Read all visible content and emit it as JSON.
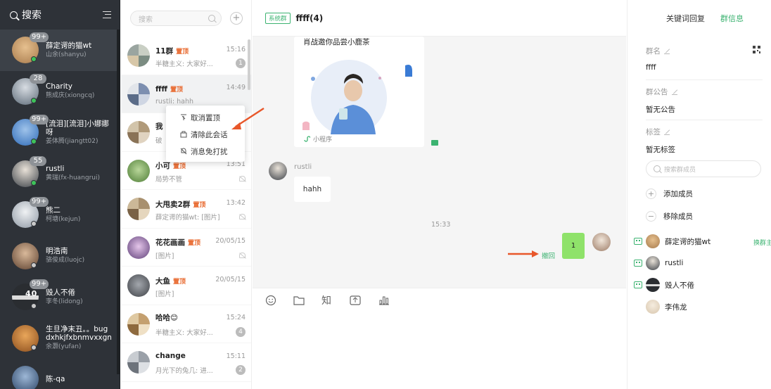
{
  "sidebar": {
    "search_label": "搜索",
    "contacts": [
      {
        "badge": "99+",
        "name": "薛定谔的猫wt",
        "sub": "山余(shanyu)",
        "status": "green",
        "color": "#c89a6a"
      },
      {
        "badge": "28",
        "name": "Charity",
        "sub": "熊成庆(xiongcq)",
        "status": "green",
        "color": "#6d7b8a"
      },
      {
        "badge": "99+",
        "name": "[流泪][流泪]小娜娜呀",
        "sub": "姜体腾(jiangtt02)",
        "status": "green",
        "color": "#5b8ed0"
      },
      {
        "badge": "55",
        "name": "rustli",
        "sub": "黄瑞(fx-huangrui)",
        "status": "green",
        "color": "#4a4f57"
      },
      {
        "badge": "99+",
        "name": "熊二",
        "sub": "柯塘(kejun)",
        "status": "grey",
        "color": "#aab3bd"
      },
      {
        "badge": "",
        "name": "明浩南",
        "sub": "骆俊成(luojc)",
        "status": "grey",
        "color": "#8a6a55"
      },
      {
        "badge": "99+",
        "name": "毁人不倦",
        "sub": "李冬(lidong)",
        "status": "grey",
        "color": "#3a3d42",
        "overlay": "40"
      },
      {
        "badge": "",
        "name": "生旦净末丑。。bug dxhkjfxbnmvxxgn",
        "sub": "余灏(yufan)",
        "status": "grey",
        "color": "#c5782f"
      },
      {
        "badge": "",
        "name": "陈-qa",
        "sub": "",
        "status": "grey",
        "color": "#5b7aa3"
      }
    ]
  },
  "list": {
    "search_placeholder": "搜索",
    "plus": "+",
    "pin_label": "置顶",
    "conversations": [
      {
        "name": "11群",
        "pinned": true,
        "time": "15:16",
        "preview": "半糖主义:  大家好...",
        "count": "1",
        "muted": false,
        "color": "#9aa5a0"
      },
      {
        "name": "ffff",
        "pinned": true,
        "time": "14:49",
        "preview": "rustli:  hahh",
        "count": "",
        "muted": false,
        "color": "#7d8fb0"
      },
      {
        "name": "我",
        "pinned": false,
        "time": "",
        "preview": "破",
        "count": "",
        "muted": false,
        "color": "#b09a7a"
      },
      {
        "name": "小可",
        "pinned": true,
        "time": "13:51",
        "preview": "局势不管",
        "count": "",
        "muted": true,
        "color": "#7aa860"
      },
      {
        "name": "大甩卖2群",
        "pinned": true,
        "time": "13:42",
        "preview": "薛定谔的猫wt:  [图片]",
        "count": "",
        "muted": true,
        "color": "#a8906e"
      },
      {
        "name": "花花画画",
        "pinned": true,
        "time": "20/05/15",
        "preview": "[图片]",
        "count": "",
        "muted": true,
        "color": "#8a6aa0"
      },
      {
        "name": "大鱼",
        "pinned": true,
        "time": "20/05/15",
        "preview": "[图片]",
        "count": "",
        "muted": false,
        "color": "#6b6e73"
      },
      {
        "name": "哈哈😊",
        "pinned": false,
        "time": "15:24",
        "preview": "半糖主义:  大家好...",
        "count": "4",
        "muted": false,
        "color": "#c4a070"
      },
      {
        "name": "change",
        "pinned": false,
        "time": "15:11",
        "preview": "月光下的兔几:  进...",
        "count": "2",
        "muted": false,
        "color": "#9aa0a8"
      }
    ]
  },
  "context_menu": {
    "items": [
      "取消置顶",
      "清除此会话",
      "消息免打扰"
    ]
  },
  "chat": {
    "system_tag": "系统群",
    "title": "ffff(4)",
    "card_title": "肖战邀你品尝小鹿茶",
    "card_footer": "小程序",
    "sender": "rustli",
    "message": "hahh",
    "timestamp": "15:33",
    "my_message": "1",
    "recall": "撤回",
    "toolbar": {
      "knowledge": "知"
    }
  },
  "right": {
    "tabs": [
      "关键词回复",
      "群信息"
    ],
    "group_name_label": "群名",
    "group_name": "ffff",
    "announcement_label": "群公告",
    "announcement": "暂无公告",
    "tag_label": "标签",
    "tag_value": "暂无标签",
    "member_search_placeholder": "搜索群成员",
    "add_member": "添加成员",
    "remove_member": "移除成员",
    "transfer_owner": "换群主",
    "members": [
      {
        "name": "薛定谔的猫wt",
        "robot": true,
        "color": "#c89a6a"
      },
      {
        "name": "rustli",
        "robot": true,
        "color": "#4a4f57"
      },
      {
        "name": "毁人不倦",
        "robot": true,
        "color": "#3a3d42"
      },
      {
        "name": "李伟龙",
        "robot": false,
        "color": "#e8dccb"
      }
    ]
  },
  "colors": {
    "accent": "#3cb371",
    "pin": "#e8662a",
    "arrow": "#e8572a",
    "bubble_green": "#8fe26a"
  }
}
